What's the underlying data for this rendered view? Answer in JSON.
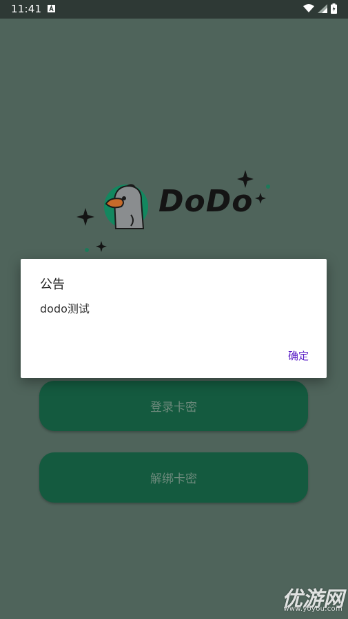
{
  "status_bar": {
    "time": "11:41",
    "icons": [
      "a-notification-icon",
      "wifi-icon",
      "signal-icon",
      "battery-icon"
    ]
  },
  "logo": {
    "text": "DoDo"
  },
  "buttons": {
    "login_label": "登录卡密",
    "unbind_label": "解绑卡密"
  },
  "dialog": {
    "title": "公告",
    "message": "dodo测试",
    "confirm_label": "确定"
  },
  "watermark": {
    "text": "优游网",
    "url": "www.yoyou.com"
  },
  "colors": {
    "background": "#4f645b",
    "button": "#145a3f",
    "accent": "#5b1fc7"
  }
}
